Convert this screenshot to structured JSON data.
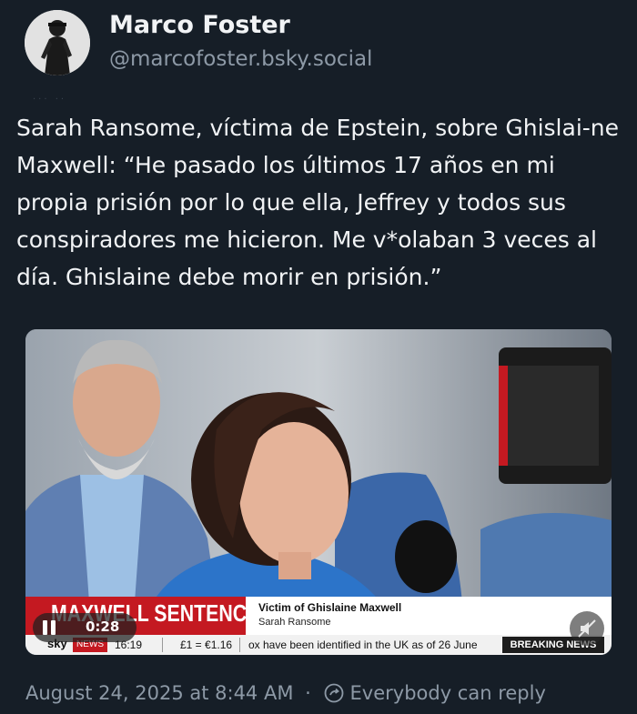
{
  "author": {
    "display_name": "Marco Foster",
    "handle": "@marcofoster.bsky.social",
    "avatar_icon": "avatar-photo"
  },
  "post": {
    "text": "Sarah Ransome, víctima de Epstein, sobre Ghislai-ne Maxwell: “He pasado los últimos 17 años en mi propia prisión por lo que ella, Jeffrey y todos sus conspiradores me hicieron. Me v*olaban 3 veces al día. Ghislaine debe morir en prisión.”"
  },
  "video": {
    "banner_title": "MAXWELL SENTENCING",
    "caption_line1": "Victim of Ghislaine Maxwell",
    "caption_line2": "Sarah Ransome",
    "channel_logo": "sky",
    "channel_badge": "NEWS",
    "clock": "16:19",
    "fx_rate": "£1 = €1.16",
    "ticker_text": "ox have been identified in the UK as of 26 June",
    "breaking_label": "BREAKING NEWS",
    "duration": "0:28",
    "pause_icon": "pause-icon",
    "mute_icon": "mute-icon",
    "accent_red": "#c41921"
  },
  "footer": {
    "timestamp": "August 24, 2025 at 8:44 AM",
    "separator": "·",
    "reply_setting": "Everybody can reply",
    "reply_icon": "reply-settings-icon"
  },
  "theme": {
    "background": "#161e27",
    "text": "#f1f3f5",
    "muted": "#8d99a6"
  }
}
